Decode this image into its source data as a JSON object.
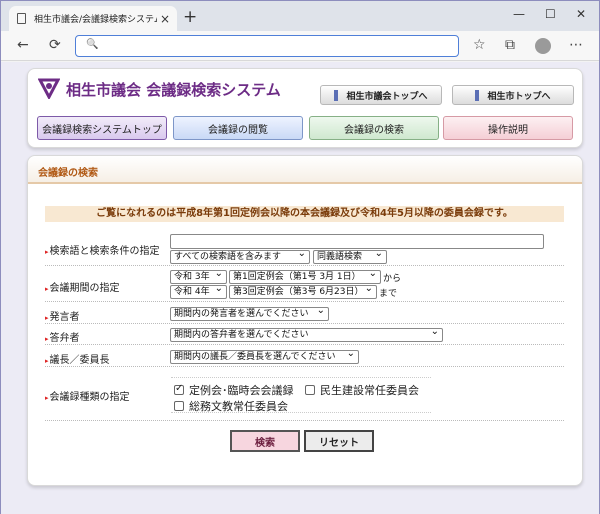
{
  "browser": {
    "tab_title": "相生市議会/会議録検索システム",
    "tab_close": "×",
    "new_tab": "+",
    "win_min": "—",
    "win_max": "☐",
    "win_close": "✕",
    "back": "←",
    "reload": "⟳",
    "search_icon": "🔍",
    "address_value": "",
    "star_icon": "☆",
    "collections_icon": "⧉",
    "more_icon": "⋯"
  },
  "header": {
    "site_title": "相生市議会 会議録検索システム",
    "link_council_top": "相生市議会トップへ",
    "link_city_top": "相生市トップへ",
    "nav": [
      "会議録検索システムトップ",
      "会議録の閲覧",
      "会議録の検索",
      "操作説明"
    ]
  },
  "panel": {
    "title": "会議録の検索",
    "notice": "ご覧になれるのは平成8年第1回定例会以降の本会議録及び令和4年5月以降の委員会録です。"
  },
  "form": {
    "keyword_label": "検索語と検索条件の指定",
    "keyword_value": "",
    "keyword_mode": "すべての検索語を含みます",
    "synonym_mode": "同義語検索",
    "period_label": "会議期間の指定",
    "from_year": "令和 3年",
    "from_session": "第1回定例会（第1号 3月 1日）",
    "from_suffix": "から",
    "to_year": "令和 4年",
    "to_session": "第3回定例会（第3号 6月23日）",
    "to_suffix": "まで",
    "speaker_label": "発言者",
    "speaker_value": "期間内の発言者を選んでください",
    "answerer_label": "答弁者",
    "answerer_value": "期間内の答弁者を選んでください",
    "chair_label": "議長／委員長",
    "chair_value": "期間内の議長／委員長を選んでください",
    "type_label": "会議録種類の指定",
    "types": [
      {
        "label": "定例会･臨時会会議録",
        "checked": true
      },
      {
        "label": "民生建設常任委員会",
        "checked": false
      },
      {
        "label": "総務文教常任委員会",
        "checked": false
      }
    ],
    "search_button": "検索",
    "reset_button": "リセット"
  }
}
